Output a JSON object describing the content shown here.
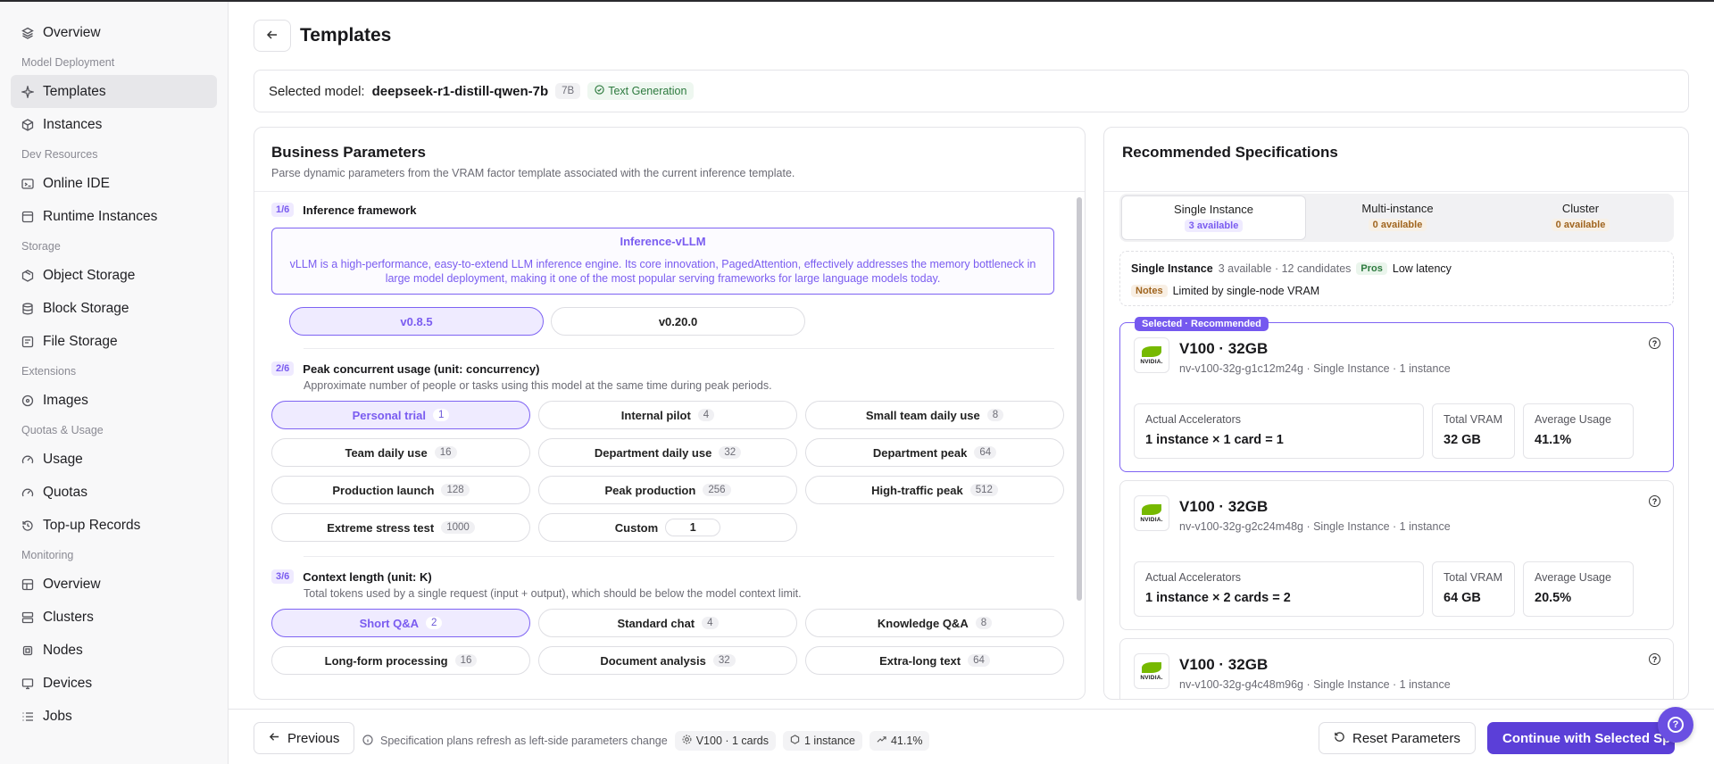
{
  "sidebar": {
    "items": [
      {
        "label": "Overview",
        "icon": "layers-icon"
      },
      {
        "section": "Model Deployment"
      },
      {
        "label": "Templates",
        "icon": "sparkle-icon",
        "active": true
      },
      {
        "label": "Instances",
        "icon": "box-icon"
      },
      {
        "section": "Dev Resources"
      },
      {
        "label": "Online IDE",
        "icon": "terminal-icon"
      },
      {
        "label": "Runtime Instances",
        "icon": "square-icon"
      },
      {
        "section": "Storage"
      },
      {
        "label": "Object Storage",
        "icon": "package-icon"
      },
      {
        "label": "Block Storage",
        "icon": "database-icon"
      },
      {
        "label": "File Storage",
        "icon": "file-icon"
      },
      {
        "section": "Extensions"
      },
      {
        "label": "Images",
        "icon": "disc-icon"
      },
      {
        "section": "Quotas & Usage"
      },
      {
        "label": "Usage",
        "icon": "gauge-icon"
      },
      {
        "label": "Quotas",
        "icon": "gauge-icon"
      },
      {
        "label": "Top-up Records",
        "icon": "receipt-icon"
      },
      {
        "section": "Monitoring"
      },
      {
        "label": "Overview",
        "icon": "grid-icon"
      },
      {
        "label": "Clusters",
        "icon": "server-icon"
      },
      {
        "label": "Nodes",
        "icon": "cpu-icon"
      },
      {
        "label": "Devices",
        "icon": "monitor-icon"
      },
      {
        "label": "Jobs",
        "icon": "list-icon"
      }
    ]
  },
  "header": {
    "title": "Templates"
  },
  "model": {
    "label": "Selected model:",
    "name": "deepseek-r1-distill-qwen-7b",
    "size": "7B",
    "task": "Text Generation"
  },
  "business": {
    "title": "Business Parameters",
    "subtitle": "Parse dynamic parameters from the VRAM factor template associated with the current inference template.",
    "steps": {
      "s1": {
        "num": "1/6",
        "title": "Inference framework"
      },
      "s2": {
        "num": "2/6",
        "title": "Peak concurrent usage (unit: concurrency)",
        "desc": "Approximate number of people or tasks using this model at the same time during peak periods."
      },
      "s3": {
        "num": "3/6",
        "title": "Context length (unit: K)",
        "desc": "Total tokens used by a single request (input + output), which should be below the model context limit."
      }
    },
    "framework": {
      "name": "Inference-vLLM",
      "desc": "vLLM is a high-performance, easy-to-extend LLM inference engine. Its core innovation, PagedAttention, effectively addresses the memory bottleneck in large model deployment, making it one of the most popular serving frameworks for large language models today."
    },
    "versions": [
      "v0.8.5",
      "v0.20.0"
    ],
    "concurrency": [
      {
        "label": "Personal trial",
        "count": "1"
      },
      {
        "label": "Internal pilot",
        "count": "4"
      },
      {
        "label": "Small team daily use",
        "count": "8"
      },
      {
        "label": "Team daily use",
        "count": "16"
      },
      {
        "label": "Department daily use",
        "count": "32"
      },
      {
        "label": "Department peak",
        "count": "64"
      },
      {
        "label": "Production launch",
        "count": "128"
      },
      {
        "label": "Peak production",
        "count": "256"
      },
      {
        "label": "High-traffic peak",
        "count": "512"
      },
      {
        "label": "Extreme stress test",
        "count": "1000"
      },
      {
        "label": "Custom",
        "count": "1"
      }
    ],
    "context": [
      {
        "label": "Short Q&A",
        "count": "2"
      },
      {
        "label": "Standard chat",
        "count": "4"
      },
      {
        "label": "Knowledge Q&A",
        "count": "8"
      },
      {
        "label": "Long-form processing",
        "count": "16"
      },
      {
        "label": "Document analysis",
        "count": "32"
      },
      {
        "label": "Extra-long text",
        "count": "64"
      }
    ]
  },
  "recommend": {
    "title": "Recommended Specifications",
    "tabs": [
      {
        "label": "Single Instance",
        "badge": "3 available"
      },
      {
        "label": "Multi-instance",
        "badge": "0 available"
      },
      {
        "label": "Cluster",
        "badge": "0 available"
      }
    ],
    "summary": {
      "mode": "Single Instance",
      "stats": "3 available · 12 candidates",
      "pros_tag": "Pros",
      "pros": "Low latency",
      "notes_tag": "Notes",
      "notes": "Limited by single-node VRAM"
    },
    "selected_badge": "Selected · Recommended",
    "metric_labels": {
      "acc": "Actual Accelerators",
      "vram": "Total VRAM",
      "usage": "Average Usage"
    },
    "specs": [
      {
        "name": "V100 · 32GB",
        "sub": "nv-v100-32g-g1c12m24g · Single Instance · 1 instance",
        "acc": "1 instance × 1 card = 1",
        "vram": "32 GB",
        "usage": "41.1%"
      },
      {
        "name": "V100 · 32GB",
        "sub": "nv-v100-32g-g2c24m48g · Single Instance · 1 instance",
        "acc": "1 instance × 2 cards = 2",
        "vram": "64 GB",
        "usage": "20.5%"
      },
      {
        "name": "V100 · 32GB",
        "sub": "nv-v100-32g-g4c48m96g · Single Instance · 1 instance"
      }
    ]
  },
  "footer": {
    "previous": "Previous",
    "hint": "Specification plans refresh as left-side parameters change",
    "chips": [
      "V100 · 1 cards",
      "1 instance",
      "41.1%"
    ],
    "reset": "Reset Parameters",
    "continue": "Continue with Selected Spe"
  },
  "colors": {
    "accent": "#7559ef",
    "accent_dark": "#5b3fd8",
    "nvidia_green": "#76b900"
  }
}
